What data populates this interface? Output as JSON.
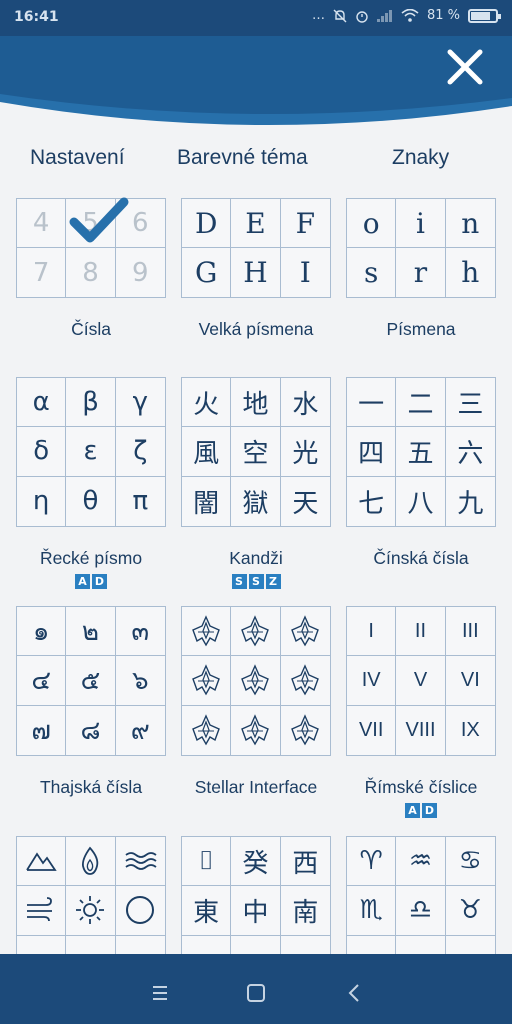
{
  "status": {
    "time": "16:41",
    "battery_text": "81 %",
    "battery_level": 0.81,
    "icons": [
      "dots-icon",
      "mute-icon",
      "alarm-icon",
      "signal-icon",
      "wifi-icon",
      "battery-icon"
    ]
  },
  "header": {
    "close_icon": "close-icon",
    "colors": {
      "primary": "#1c4a7a",
      "accent": "#2a7fc1"
    }
  },
  "tabs": [
    {
      "label": "Nastavení"
    },
    {
      "label": "Barevné téma"
    },
    {
      "label": "Znaky"
    }
  ],
  "cards": [
    {
      "id": "cisla",
      "label": "Čísla",
      "cells": [
        "4",
        "5",
        "6",
        "7",
        "8",
        "9"
      ],
      "selected": true
    },
    {
      "id": "velka",
      "label": "Velká písmena",
      "cells": [
        "D",
        "E",
        "F",
        "G",
        "H",
        "I"
      ]
    },
    {
      "id": "pismena",
      "label": "Písmena",
      "cells": [
        "o",
        "i",
        "n",
        "s",
        "r",
        "h"
      ]
    },
    {
      "id": "recke",
      "label": "Řecké písmo",
      "badge": [
        "A",
        "D"
      ],
      "cells": [
        "α",
        "β",
        "γ",
        "δ",
        "ε",
        "ζ",
        "η",
        "θ",
        "π"
      ]
    },
    {
      "id": "kandzi",
      "label": "Kandži",
      "badge": [
        "S",
        "S",
        "Z"
      ],
      "cells": [
        "火",
        "地",
        "水",
        "風",
        "空",
        "光",
        "闇",
        "獄",
        "天"
      ]
    },
    {
      "id": "cinska",
      "label": "Čínská čísla",
      "cells": [
        "一",
        "二",
        "三",
        "四",
        "五",
        "六",
        "七",
        "八",
        "九"
      ]
    },
    {
      "id": "thajska",
      "label": "Thajská čísla",
      "cells": [
        "๑",
        "๒",
        "๓",
        "๔",
        "๕",
        "๖",
        "๗",
        "๘",
        "๙"
      ]
    },
    {
      "id": "stellar",
      "label": "Stellar Interface",
      "icons": [
        "ship-icon",
        "ship-icon",
        "ship-icon",
        "ship-icon",
        "ship-icon",
        "ship-icon",
        "ship-icon",
        "ship-icon",
        "ship-icon"
      ]
    },
    {
      "id": "rimske",
      "label": "Římské číslice",
      "badge": [
        "A",
        "D"
      ],
      "cells": [
        "I",
        "II",
        "III",
        "IV",
        "V",
        "VI",
        "VII",
        "VIII",
        "IX"
      ]
    },
    {
      "id": "elementy",
      "icons": [
        "mountain-icon",
        "flame-icon",
        "waves-icon",
        "wind-icon",
        "sun-icon",
        "circle-icon"
      ]
    },
    {
      "id": "znaky",
      "cells": [
        "⌷",
        "癸",
        "西",
        "東",
        "中",
        "南"
      ]
    },
    {
      "id": "zverokruh",
      "cells": [
        "♈",
        "♒",
        "♋",
        "♏",
        "♎",
        "♉"
      ]
    }
  ],
  "nav": {
    "icons": [
      "menu-icon",
      "home-icon",
      "back-icon"
    ]
  }
}
